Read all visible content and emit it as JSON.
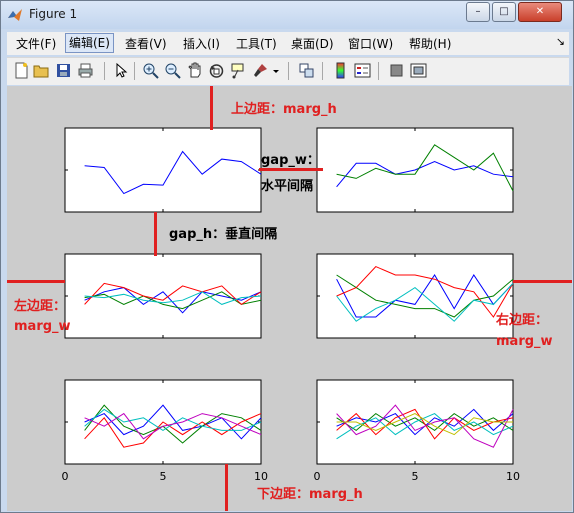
{
  "window": {
    "title": "Figure 1",
    "minimize_label": "–",
    "maximize_label": "□",
    "close_label": "✕"
  },
  "menu": {
    "items": [
      "文件(F)",
      "编辑(E)",
      "查看(V)",
      "插入(I)",
      "工具(T)",
      "桌面(D)",
      "窗口(W)",
      "帮助(H)"
    ],
    "overflow": "↘"
  },
  "toolbar": {
    "icons": [
      "new-figure-icon",
      "open-file-icon",
      "save-icon",
      "print-icon",
      "pointer-icon",
      "zoom-in-icon",
      "zoom-out-icon",
      "pan-icon",
      "rotate-3d-icon",
      "data-cursor-icon",
      "brush-icon",
      "brush-dropdown-icon",
      "link-plot-icon",
      "colorbar-icon",
      "legend-icon",
      "hide-plot-tools-icon",
      "show-plot-tools-icon"
    ]
  },
  "annotations": {
    "top_margin": "上边距：marg_h",
    "gap_w_line1": "gap_w：",
    "gap_w_line2": "水平间隔",
    "gap_h": "gap_h：垂直间隔",
    "left_margin_line1": "左边距：",
    "left_margin_line2": "marg_w",
    "right_margin_line1": "右边距：",
    "right_margin_line2": "marg_w",
    "bottom_margin": "下边距：marg_h"
  },
  "colors": {
    "annotation_red": "#e02020",
    "series": [
      "#0000ff",
      "#008000",
      "#ff0000",
      "#00bfbf",
      "#bf00bf",
      "#bfbf00"
    ]
  },
  "chart_data": [
    {
      "type": "line",
      "panel": "row1-left",
      "x": [
        1,
        2,
        3,
        4,
        5,
        6,
        7,
        8,
        9,
        10
      ],
      "xlim": [
        0,
        10
      ],
      "series": [
        {
          "values": [
            0.55,
            0.53,
            0.22,
            0.33,
            0.32,
            0.72,
            0.45,
            0.63,
            0.6,
            0.45
          ]
        }
      ]
    },
    {
      "type": "line",
      "panel": "row1-right",
      "x": [
        1,
        2,
        3,
        4,
        5,
        6,
        7,
        8,
        9,
        10
      ],
      "xlim": [
        0,
        10
      ],
      "series": [
        {
          "values": [
            0.3,
            0.58,
            0.58,
            0.45,
            0.5,
            0.6,
            0.5,
            0.55,
            0.45,
            0.42
          ]
        },
        {
          "values": [
            0.45,
            0.4,
            0.52,
            0.45,
            0.45,
            0.8,
            0.65,
            0.5,
            0.7,
            0.25
          ]
        }
      ]
    },
    {
      "type": "line",
      "panel": "row2-left",
      "x": [
        1,
        2,
        3,
        4,
        5,
        6,
        7,
        8,
        9,
        10
      ],
      "xlim": [
        0,
        10
      ],
      "series": [
        {
          "values": [
            0.45,
            0.55,
            0.6,
            0.4,
            0.55,
            0.3,
            0.55,
            0.5,
            0.45,
            0.55
          ]
        },
        {
          "values": [
            0.48,
            0.52,
            0.4,
            0.5,
            0.4,
            0.35,
            0.45,
            0.55,
            0.4,
            0.45
          ]
        },
        {
          "values": [
            0.4,
            0.65,
            0.6,
            0.5,
            0.45,
            0.62,
            0.55,
            0.62,
            0.4,
            0.55
          ]
        },
        {
          "values": [
            0.5,
            0.48,
            0.52,
            0.45,
            0.42,
            0.45,
            0.55,
            0.4,
            0.48,
            0.5
          ]
        }
      ]
    },
    {
      "type": "line",
      "panel": "row2-right",
      "x": [
        1,
        2,
        3,
        4,
        5,
        6,
        7,
        8,
        9,
        10
      ],
      "xlim": [
        0,
        10
      ],
      "series": [
        {
          "values": [
            0.7,
            0.25,
            0.25,
            0.45,
            0.4,
            0.75,
            0.35,
            0.75,
            0.4,
            0.65
          ]
        },
        {
          "values": [
            0.75,
            0.6,
            0.45,
            0.4,
            0.35,
            0.35,
            0.25,
            0.45,
            0.5,
            0.7
          ]
        },
        {
          "values": [
            0.5,
            0.6,
            0.85,
            0.75,
            0.75,
            0.7,
            0.6,
            0.55,
            0.25,
            0.65
          ]
        },
        {
          "values": [
            0.5,
            0.2,
            0.35,
            0.45,
            0.6,
            0.4,
            0.2,
            0.45,
            0.4,
            0.65
          ]
        }
      ]
    },
    {
      "type": "line",
      "panel": "row3-left",
      "x": [
        1,
        2,
        3,
        4,
        5,
        6,
        7,
        8,
        9,
        10
      ],
      "xlim": [
        0,
        10
      ],
      "xticks": [
        0,
        5,
        10
      ],
      "series": [
        {
          "values": [
            0.5,
            0.6,
            0.35,
            0.45,
            0.7,
            0.4,
            0.45,
            0.55,
            0.3,
            0.55
          ]
        },
        {
          "values": [
            0.4,
            0.7,
            0.45,
            0.35,
            0.45,
            0.25,
            0.45,
            0.6,
            0.55,
            0.4
          ]
        },
        {
          "values": [
            0.3,
            0.55,
            0.2,
            0.25,
            0.5,
            0.35,
            0.5,
            0.35,
            0.5,
            0.6
          ]
        },
        {
          "values": [
            0.45,
            0.65,
            0.5,
            0.55,
            0.4,
            0.55,
            0.45,
            0.4,
            0.4,
            0.5
          ]
        },
        {
          "values": [
            0.55,
            0.45,
            0.6,
            0.3,
            0.45,
            0.5,
            0.6,
            0.55,
            0.45,
            0.35
          ]
        }
      ]
    },
    {
      "type": "line",
      "panel": "row3-right",
      "x": [
        1,
        2,
        3,
        4,
        5,
        6,
        7,
        8,
        9,
        10
      ],
      "xlim": [
        0,
        10
      ],
      "xticks": [
        0,
        5,
        10
      ],
      "series": [
        {
          "values": [
            0.45,
            0.55,
            0.5,
            0.6,
            0.35,
            0.55,
            0.45,
            0.65,
            0.4,
            0.6
          ]
        },
        {
          "values": [
            0.55,
            0.4,
            0.6,
            0.45,
            0.55,
            0.4,
            0.6,
            0.45,
            0.55,
            0.4
          ]
        },
        {
          "values": [
            0.4,
            0.6,
            0.35,
            0.55,
            0.65,
            0.3,
            0.55,
            0.4,
            0.5,
            0.55
          ]
        },
        {
          "values": [
            0.3,
            0.45,
            0.55,
            0.35,
            0.5,
            0.6,
            0.4,
            0.5,
            0.35,
            0.45
          ]
        },
        {
          "values": [
            0.6,
            0.35,
            0.45,
            0.7,
            0.4,
            0.5,
            0.55,
            0.3,
            0.2,
            0.65
          ]
        },
        {
          "values": [
            0.5,
            0.5,
            0.4,
            0.5,
            0.6,
            0.45,
            0.35,
            0.55,
            0.5,
            0.5
          ]
        }
      ]
    }
  ]
}
